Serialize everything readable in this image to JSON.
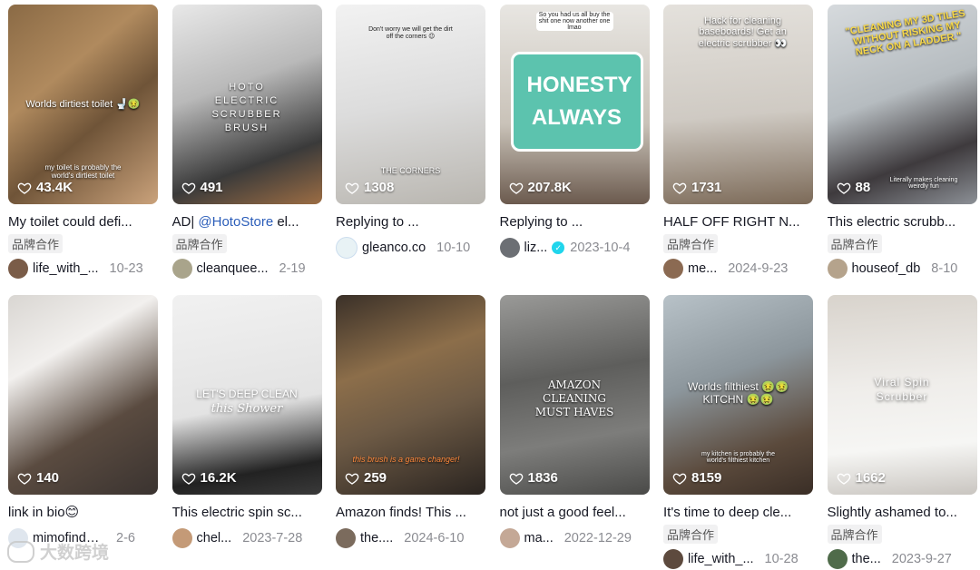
{
  "videos": [
    {
      "likes": "43.4K",
      "title": "My toilet could defi...",
      "badge": "品牌合作",
      "author": "life_with_...",
      "date": "10-23",
      "overlay": "Worlds dirtiest toilet 🚽🤢",
      "overlay2": "my toilet is probably the world's dirtiest toilet"
    },
    {
      "likes": "491",
      "title_pre": "AD| ",
      "title_mention": "@HotoStore",
      "title_post": " el...",
      "badge": "品牌合作",
      "author": "cleanquee...",
      "date": "2-19",
      "overlay": "HOTO ELECTRIC SCRUBBER BRUSH"
    },
    {
      "likes": "1308",
      "title": "Replying to ...",
      "author": "gleanco.co",
      "date": "10-10",
      "overlay": "Don't worry we will get the dirt off the corners 😉",
      "overlay2": "THE CORNERS"
    },
    {
      "likes": "207.8K",
      "title": "Replying to ...",
      "author": "liz...",
      "date": "2023-10-4",
      "overlay": "HONESTY ALWAYS",
      "overlay2": "So you had us all buy the shit one now another one lmao"
    },
    {
      "likes": "1731",
      "title": "HALF OFF RIGHT N...",
      "badge": "品牌合作",
      "author": "me...",
      "date": "2024-9-23",
      "overlay": "Hack for cleaning baseboards! Get an electric scrubber 👀"
    },
    {
      "likes": "88",
      "title": "This electric scrubb...",
      "badge": "品牌合作",
      "author": "houseof_db",
      "date": "8-10",
      "overlay": "\"CLEANING MY 3D TILES WITHOUT RISKING MY NECK ON A LADDER.\"",
      "overlay2": "Literally makes cleaning weirdly fun"
    },
    {
      "likes": "140",
      "title": "link in bio😊",
      "author": "mimofinds....",
      "date": "2-6"
    },
    {
      "likes": "16.2K",
      "title": "This electric spin sc...",
      "author": "chel...",
      "date": "2023-7-28",
      "overlay": "LET'S DEEP CLEAN",
      "overlay2": "this Shower"
    },
    {
      "likes": "259",
      "title": "Amazon finds! This ...",
      "author": "the....",
      "date": "2024-6-10",
      "overlay": "this brush is a game changer!"
    },
    {
      "likes": "1836",
      "title": "not just a good feel...",
      "author": "ma...",
      "date": "2022-12-29",
      "overlay": "AMAZON CLEANING MUST HAVES"
    },
    {
      "likes": "8159",
      "title": "It's time to deep cle...",
      "badge": "品牌合作",
      "author": "life_with_...",
      "date": "10-28",
      "overlay": "Worlds filthiest 🤢🤢 KITCHN 🤢🤢",
      "overlay2": "my kitchen is probably the world's filthiest kitchen"
    },
    {
      "likes": "1662",
      "title": "Slightly ashamed to...",
      "badge": "品牌合作",
      "author": "the...",
      "date": "2023-9-27",
      "overlay": "Viral Spin Scrubber"
    }
  ],
  "watermark": "大数跨境",
  "colors": {
    "text": "#161823",
    "muted": "#8a8b91",
    "mention": "#2b5db9",
    "badge_bg": "#f1f1f2",
    "verified": "#20d5ec"
  }
}
